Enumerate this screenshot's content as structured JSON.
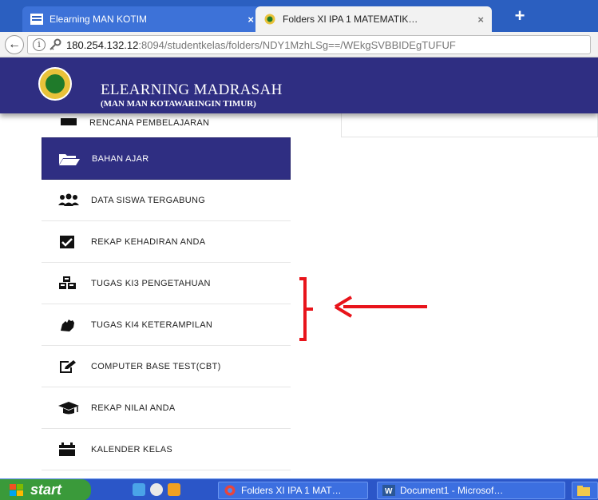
{
  "browser": {
    "tabs": [
      {
        "label": "Elearning MAN KOTIM",
        "close": "×",
        "icon": "menu-icon"
      },
      {
        "label": "Folders XI IPA 1 MATEMATIK…",
        "close": "×",
        "icon": "madrasah-logo-icon"
      }
    ],
    "new_tab": "+",
    "back": "←",
    "url_host": "180.254.132.12",
    "url_rest": ":8094/studentkelas/folders/NDY1MzhLSg==/WEkgSVBBIDEgTUFUF",
    "info_glyph": "i"
  },
  "header": {
    "title": "ELEARNING MADRASAH",
    "subtitle": "(MAN MAN KOTAWARINGIN TIMUR)"
  },
  "sidebar": {
    "items": [
      {
        "label": "RENCANA PEMBELAJARAN",
        "icon": "laptop-icon"
      },
      {
        "label": "BAHAN AJAR",
        "icon": "folder-open-icon",
        "active": true
      },
      {
        "label": "DATA SISWA TERGABUNG",
        "icon": "users-icon"
      },
      {
        "label": "REKAP KEHADIRAN ANDA",
        "icon": "check-square-icon"
      },
      {
        "label": "TUGAS KI3 PENGETAHUAN",
        "icon": "cubes-icon"
      },
      {
        "label": "TUGAS KI4 KETERAMPILAN",
        "icon": "hand-icon"
      },
      {
        "label": "COMPUTER BASE TEST(CBT)",
        "icon": "edit-icon"
      },
      {
        "label": "REKAP NILAI ANDA",
        "icon": "graduation-cap-icon"
      },
      {
        "label": "KALENDER KELAS",
        "icon": "calendar-icon"
      }
    ]
  },
  "taskbar": {
    "start": "start",
    "windows": [
      {
        "label": "Folders XI IPA 1 MAT…",
        "icon": "chrome-icon"
      },
      {
        "label": "Document1 - Microsof…",
        "icon": "word-icon"
      }
    ]
  },
  "colors": {
    "header_bg": "#2f2e82",
    "annotation_red": "#e8141b"
  }
}
